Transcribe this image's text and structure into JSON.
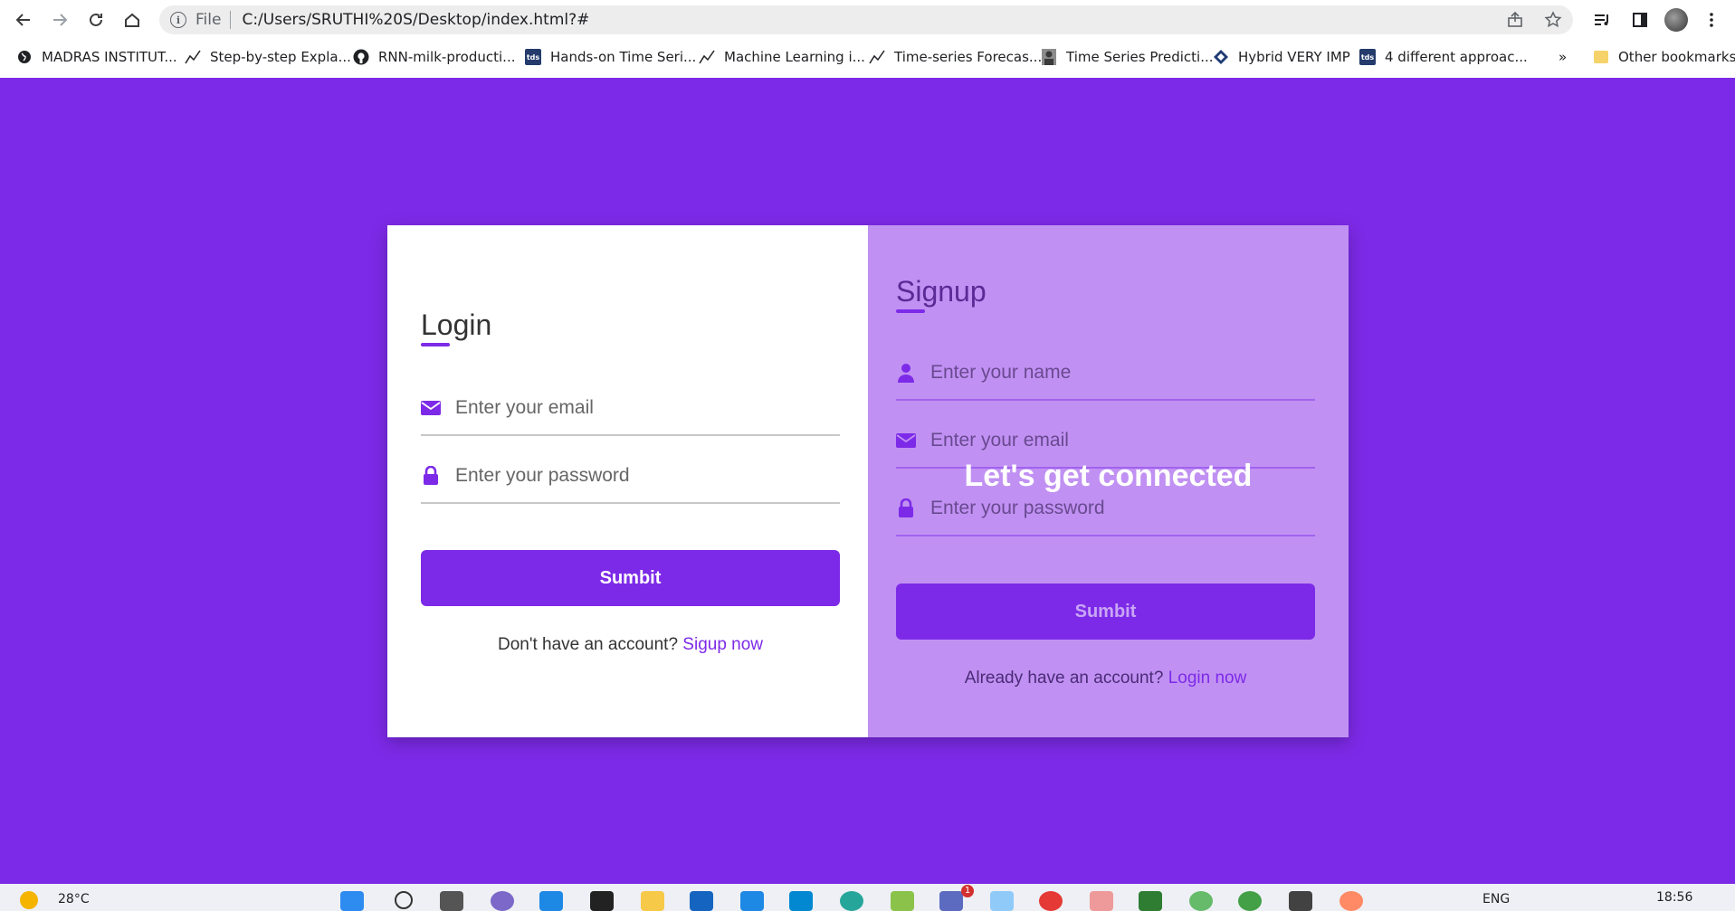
{
  "browser": {
    "file_label": "File",
    "url": "C:/Users/SRUTHI%20S/Desktop/index.html?#",
    "bookmarks": [
      "MADRAS INSTITUT...",
      "Step-by-step Expla...",
      "RNN-milk-producti...",
      "Hands-on Time Seri...",
      "Machine Learning i...",
      "Time-series Forecas...",
      "Time Series Predicti...",
      "Hybrid VERY IMP",
      "4 different approac..."
    ],
    "overflow": "»",
    "other_bookmarks": "Other bookmarks"
  },
  "login": {
    "title": "Login",
    "email_placeholder": "Enter your email",
    "password_placeholder": "Enter your password",
    "submit_label": "Sumbit",
    "switch_prompt": "Don't have an account? ",
    "switch_link": "Sigup now"
  },
  "signup": {
    "title": "Signup",
    "name_placeholder": "Enter your name",
    "email_placeholder": "Enter your email",
    "password_placeholder": "Enter your password",
    "overlay_text": "Let's get connected",
    "submit_label": "Sumbit",
    "switch_prompt": "Already have an account? ",
    "switch_link": "Login now"
  },
  "taskbar": {
    "weather": "28°C",
    "language": "ENG",
    "time": "18:56",
    "notification_badge": "1"
  },
  "colors": {
    "accent": "#7d2ae8",
    "signup_panel": "#c091f2"
  }
}
